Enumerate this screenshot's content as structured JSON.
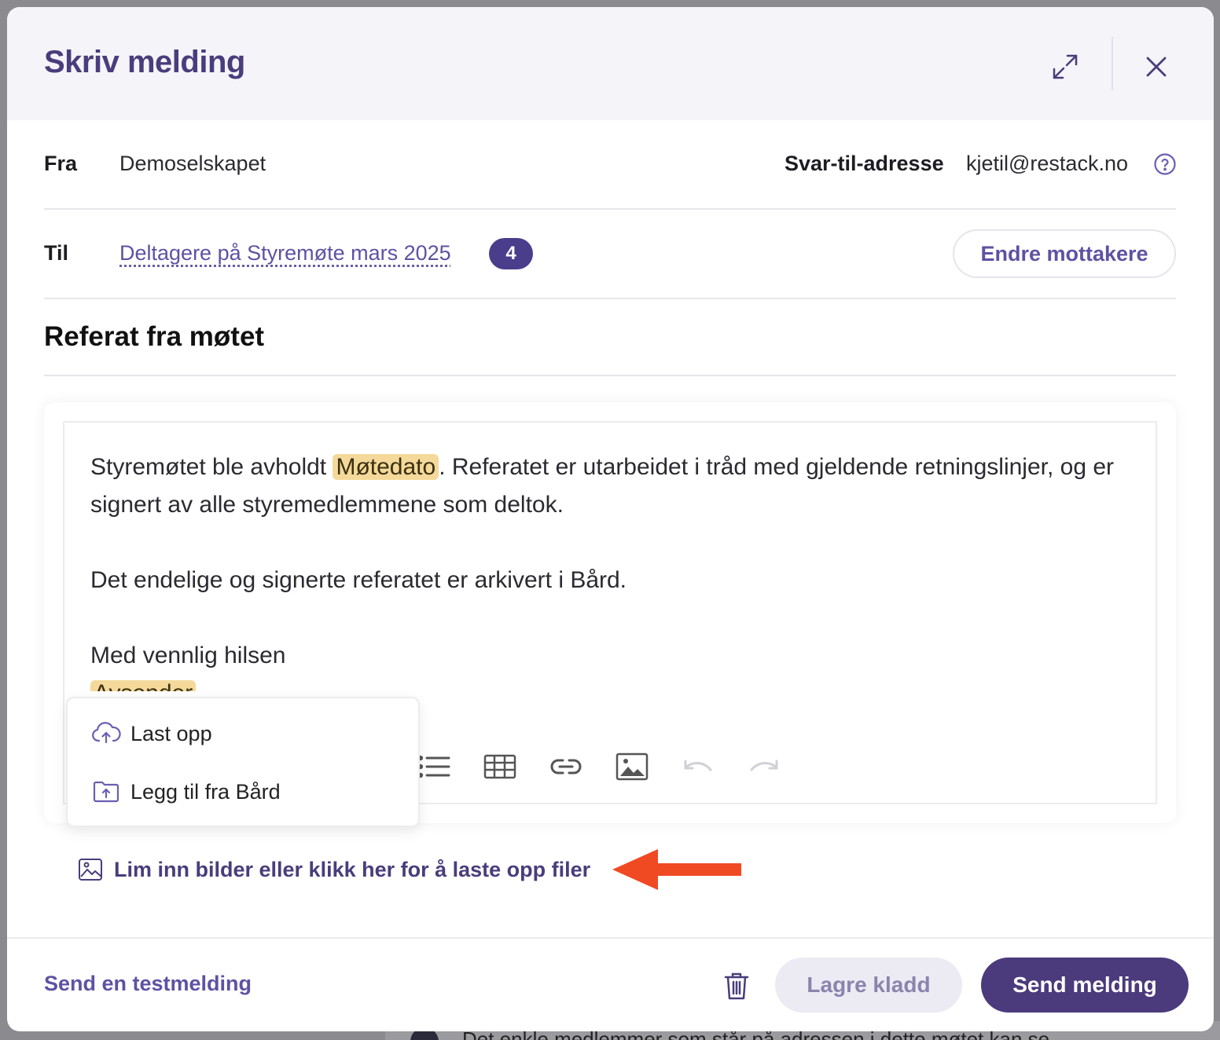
{
  "colors": {
    "brand": "#4a3d7c",
    "link": "#5e52a3",
    "badge": "#4a3d8c",
    "merge_tag": "#f4d99a",
    "arrow": "#f04a23"
  },
  "background": {
    "info_text": "Det enkle medlemmer som står på adressen i dette møtet kan se"
  },
  "modal": {
    "title": "Skriv melding",
    "expand_icon": "expand-icon",
    "close_icon": "close-icon"
  },
  "from": {
    "label": "Fra",
    "value": "Demoselskapet",
    "reply_to_label": "Svar-til-adresse",
    "reply_to_value": "kjetil@restack.no",
    "help_icon": "help-icon"
  },
  "to": {
    "label": "Til",
    "recipients_link": "Deltagere på Styremøte mars 2025",
    "count": "4",
    "change_button": "Endre mottakere"
  },
  "subject": "Referat fra møtet",
  "editor": {
    "p1_before": "Styremøtet ble avholdt ",
    "p1_tag": "Møtedato",
    "p1_after": ". Referatet er utarbeidet i tråd med gjeldende retningslinjer, og er signert av alle styremedlemmene som deltok.",
    "p2": "Det endelige og signerte referatet er arkivert i Bård.",
    "p3": "Med vennlig hilsen",
    "p4_tag": "Avsender",
    "toolbar": [
      "bullet-list-icon",
      "table-icon",
      "link-icon",
      "image-icon",
      "undo-icon",
      "redo-icon"
    ]
  },
  "upload_menu": {
    "items": [
      {
        "label": "Last opp",
        "icon": "cloud-upload-icon"
      },
      {
        "label": "Legg til fra Bård",
        "icon": "folder-upload-icon"
      }
    ]
  },
  "attachments": {
    "label": "Lim inn bilder eller klikk her for å laste opp filer",
    "icon": "image-icon"
  },
  "footer": {
    "test_link": "Send en testmelding",
    "trash_icon": "trash-icon",
    "draft_button": "Lagre kladd",
    "send_button": "Send melding"
  }
}
